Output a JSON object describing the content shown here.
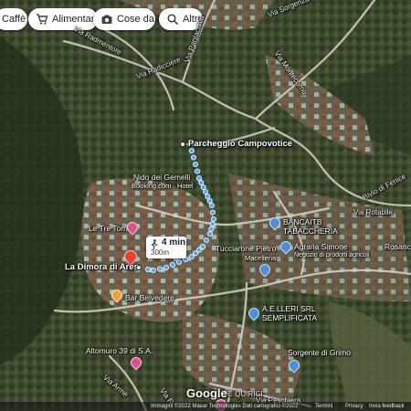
{
  "chips": [
    {
      "label": "Caffè",
      "icon": "cafe-icon"
    },
    {
      "label": "Alimentari",
      "icon": "shopping-cart-icon"
    },
    {
      "label": "Cose da fare",
      "icon": "camera-icon"
    },
    {
      "label": "Altro",
      "icon": "search-icon"
    }
  ],
  "route": {
    "time": "4 min",
    "distance": "300m",
    "color": "#4ea6ff"
  },
  "origin": {
    "label": "Parcheggio Campovotice"
  },
  "destination": {
    "label": "La Dimora di Ares"
  },
  "places": {
    "nido": "Nido dei Gemelli",
    "nido_sub": "Booking.com · Hotel",
    "tre_torri": "Le Tre Torri",
    "bar": "Bar Belvedere",
    "bancaitb": "BANCAITB",
    "tabaccheria": "TABACCHERIA",
    "tucciarone": "Tucciarone Pietro",
    "macelleria": "Macelleria",
    "agraria": "Agraria Simone",
    "agraria_sub": "Negozio di prodotti agricoli",
    "rosanc": "Rosanc",
    "aeller": "A.E.LLERI SRL",
    "semplificata": "SEMPLIFICATA",
    "sorgente": "Sorgente di Grimo",
    "altomuro": "Altomuro 39 di S.A."
  },
  "roads": {
    "via_sorgenza": "Via Sorgenza",
    "via_radmentore": "Via Radmentore",
    "via_radicciere": "Via Radicciere",
    "via_pantacchia": "Via Pantacchia",
    "via_montecorno": "Via Montecorno",
    "via_rotabile": "Via Rotabile",
    "bivio": "Bivio di Fenice",
    "via_ar": "Via Arme",
    "via_ri": "Via Ri",
    "via_peschiera": "Via Peschiera",
    "de_quirici": "DE QUIRICI"
  },
  "branding": {
    "logo": "Google"
  },
  "credits": {
    "imagery": "Immagini ©2022 Maxar Technologies Dati cartografici ©2022",
    "terms": "Termini",
    "privacy": "Privacy",
    "report": "Invia feedback"
  },
  "colors": {
    "route": "#4ea6ff",
    "pin_pink": "#e0508c",
    "pin_blue": "#4f8fd8",
    "pin_orange": "#f0a23a",
    "pin_red": "#ea4335"
  }
}
